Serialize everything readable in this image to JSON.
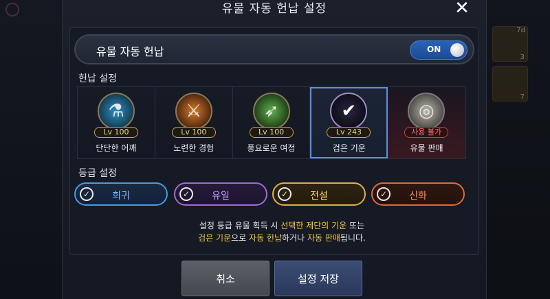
{
  "title": "유물 자동 헌납 설정",
  "auto_donate": {
    "label": "유물 자동 헌납",
    "toggle_state": "ON"
  },
  "donation_section": {
    "label": "헌납 설정"
  },
  "cards": [
    {
      "name": "단단한 어깨",
      "level": "Lv 100",
      "icon": "shield-glass-icon",
      "color": "#2f8fc4"
    },
    {
      "name": "노련한 경험",
      "level": "Lv 100",
      "icon": "sword-icon",
      "color": "#d97a2a"
    },
    {
      "name": "풍요로운 여정",
      "level": "Lv 100",
      "icon": "green-arrow-icon",
      "color": "#5fb04a"
    },
    {
      "name": "검은 기운",
      "level": "Lv 243",
      "icon": "check-icon",
      "color": "#7b6bd8"
    },
    {
      "name": "유물 판매",
      "level": "사용 불가",
      "icon": "coins-icon",
      "color": "#b9b6ad"
    }
  ],
  "grade_section": {
    "label": "등급 설정"
  },
  "grades": [
    {
      "name": "희귀",
      "color": "#4a9ae0",
      "text_color": "#7fb8ff"
    },
    {
      "name": "유일",
      "color": "#a06ad8",
      "text_color": "#c79cff"
    },
    {
      "name": "전설",
      "color": "#e0b04a",
      "text_color": "#ffd66a"
    },
    {
      "name": "신화",
      "color": "#e06a3a",
      "text_color": "#ff8a5a"
    }
  ],
  "info": {
    "line1_a": "설정 등급 유물 획득 시 ",
    "line1_b": "선택한 제단의 기운",
    "line1_c": " 또는",
    "line2_a": "검은 기운",
    "line2_b": "으로 ",
    "line2_c": "자동 헌납",
    "line2_d": "하거나 ",
    "line2_e": "자동 판매",
    "line2_f": "됩니다."
  },
  "buttons": {
    "cancel": "취소",
    "save": "설정 저장"
  },
  "background": {
    "right_slot_label_1": "7d",
    "right_slot_label_2": "3",
    "right_slot_label_3": "7"
  }
}
